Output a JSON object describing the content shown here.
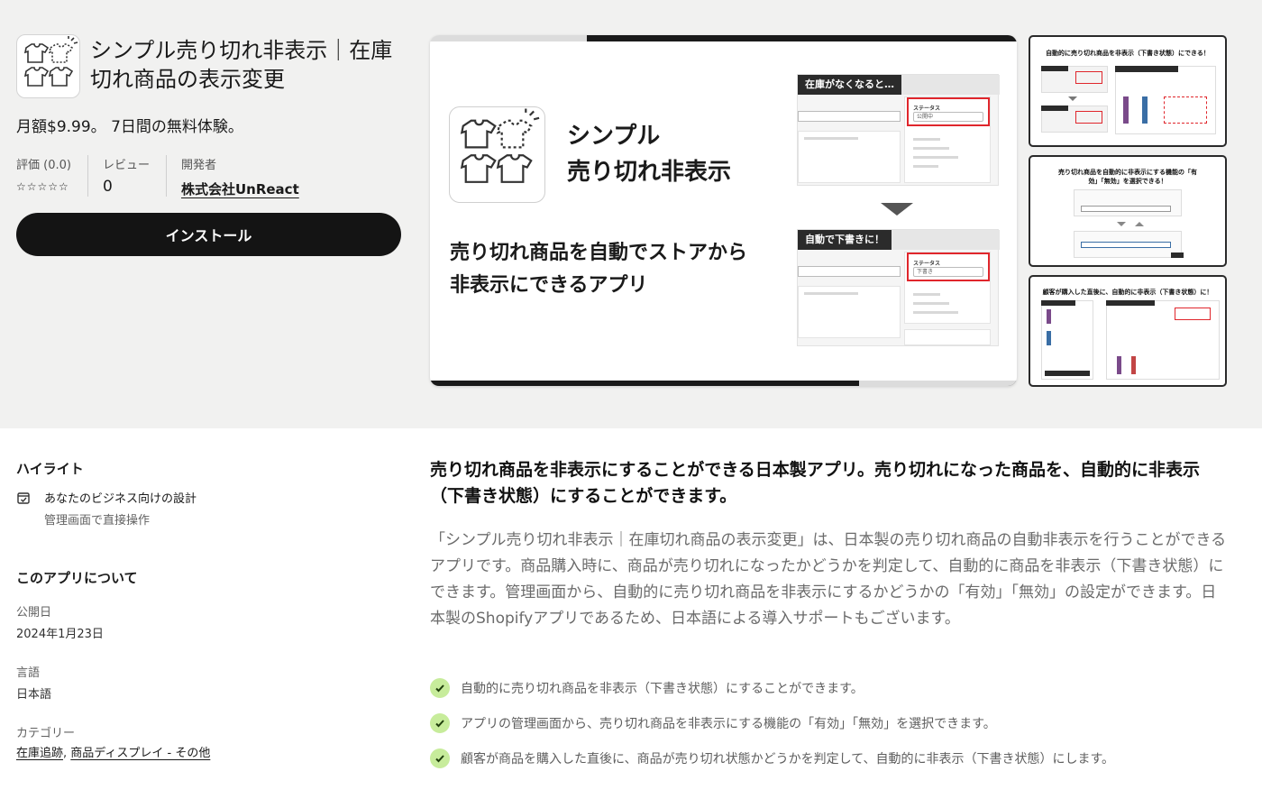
{
  "app": {
    "title": "シンプル売り切れ非表示｜在庫切れ商品の表示変更",
    "price": "月額$9.99。 7日間の無料体験。",
    "rating_label": "評価 (0.0)",
    "rating_stars": "☆☆☆☆☆",
    "reviews_label": "レビュー",
    "reviews_count": "0",
    "developer_label": "開発者",
    "developer_name": "株式会社UnReact",
    "install_label": "インストール"
  },
  "hero": {
    "name_line1": "シンプル",
    "name_line2": "売り切れ非表示",
    "tagline_line1": "売り切れ商品を自動でストアから",
    "tagline_line2": "非表示にできるアプリ",
    "mock_top_tab": "在庫がなくなると…",
    "mock_bottom_tab": "自動で下書きに！",
    "mock_status_label": "ステータス",
    "mock_status_top": "公開中",
    "mock_status_bottom": "下書き"
  },
  "thumbnails": [
    {
      "title": "自動的に売り切れ商品を非表示（下書き状態）にできる！"
    },
    {
      "title": "売り切れ商品を自動的に非表示にする機能の「有効」「無効」を選択できる！"
    },
    {
      "title": "顧客が購入した直後に、自動的に非表示（下書き状態）に！"
    }
  ],
  "highlights": {
    "heading": "ハイライト",
    "item_title": "あなたのビジネス向けの設計",
    "item_sub": "管理画面で直接操作"
  },
  "about": {
    "heading": "このアプリについて",
    "published_label": "公開日",
    "published_value": "2024年1月23日",
    "language_label": "言語",
    "language_value": "日本語",
    "category_label": "カテゴリー",
    "category_1": "在庫追跡",
    "category_sep": ",",
    "category_2": "商品ディスプレイ - その他"
  },
  "description": {
    "headline": "売り切れ商品を非表示にすることができる日本製アプリ。売り切れになった商品を、自動的に非表示（下書き状態）にすることができます。",
    "body": "「シンプル売り切れ非表示｜在庫切れ商品の表示変更」は、日本製の売り切れ商品の自動非表示を行うことができるアプリです。商品購入時に、商品が売り切れになったかどうかを判定して、自動的に商品を非表示（下書き状態）にできます。管理画面から、自動的に売り切れ商品を非表示にするかどうかの「有効」「無効」の設定ができます。日本製のShopifyアプリであるため、日本語による導入サポートもございます。",
    "features": [
      "自動的に売り切れ商品を非表示（下書き状態）にすることができます。",
      "アプリの管理画面から、売り切れ商品を非表示にする機能の「有効」「無効」を選択できます。",
      "顧客が商品を購入した直後に、商品が売り切れ状態かどうかを判定して、自動的に非表示（下書き状態）にします。"
    ]
  },
  "colors": {
    "install_bg": "#141414",
    "check_bg": "#c7ec9b",
    "highlight_red": "#e0262c"
  }
}
